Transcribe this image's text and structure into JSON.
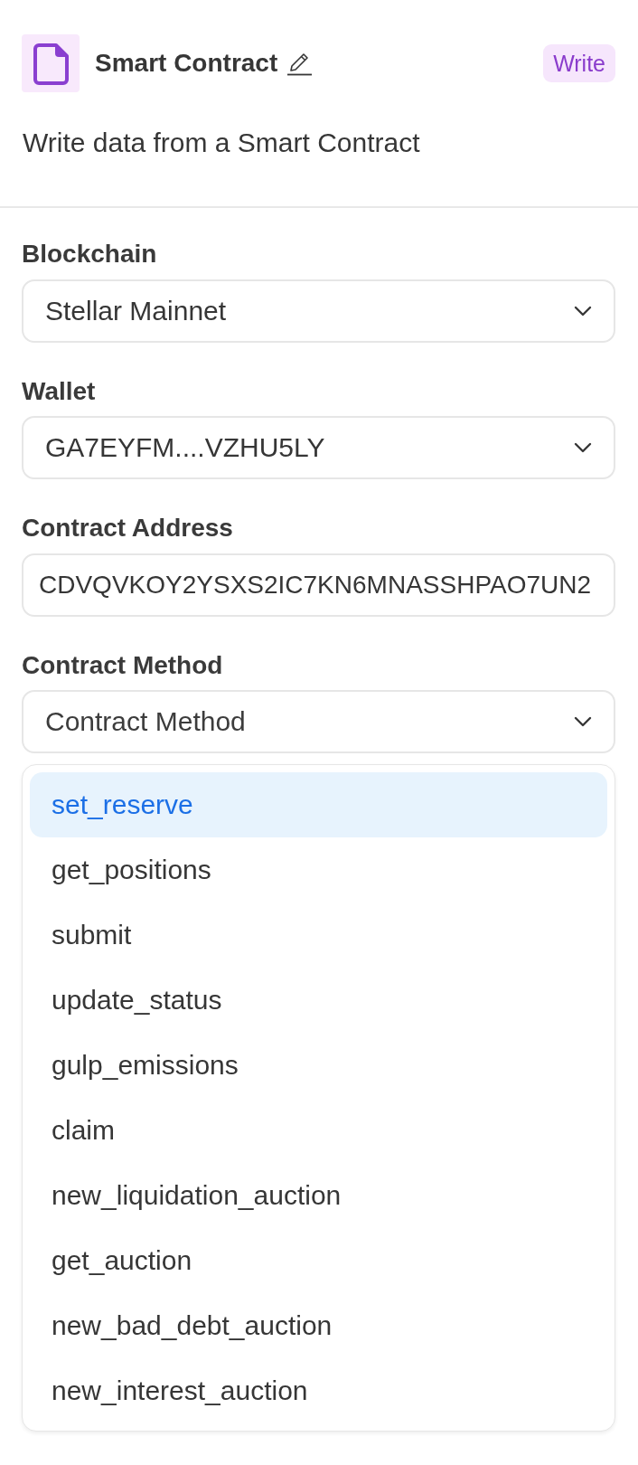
{
  "header": {
    "title": "Smart Contract",
    "badge": "Write",
    "description": "Write data from a Smart Contract"
  },
  "fields": [
    {
      "kind": "select",
      "label": "Blockchain",
      "value": "Stellar Mainnet"
    },
    {
      "kind": "select",
      "label": "Wallet",
      "value": "GA7EYFM....VZHU5LY"
    },
    {
      "kind": "text",
      "label": "Contract Address",
      "value": "CDVQVKOY2YSXS2IC7KN6MNASSHPAO7UN2"
    },
    {
      "kind": "select",
      "label": "Contract Method",
      "placeholder": "Contract Method"
    }
  ],
  "method_menu": {
    "options": [
      {
        "label": "set_reserve",
        "selected": true
      },
      {
        "label": "get_positions",
        "selected": false
      },
      {
        "label": "submit",
        "selected": false
      },
      {
        "label": "update_status",
        "selected": false
      },
      {
        "label": "gulp_emissions",
        "selected": false
      },
      {
        "label": "claim",
        "selected": false
      },
      {
        "label": "new_liquidation_auction",
        "selected": false
      },
      {
        "label": "get_auction",
        "selected": false
      },
      {
        "label": "new_bad_debt_auction",
        "selected": false
      },
      {
        "label": "new_interest_auction",
        "selected": false
      }
    ]
  }
}
